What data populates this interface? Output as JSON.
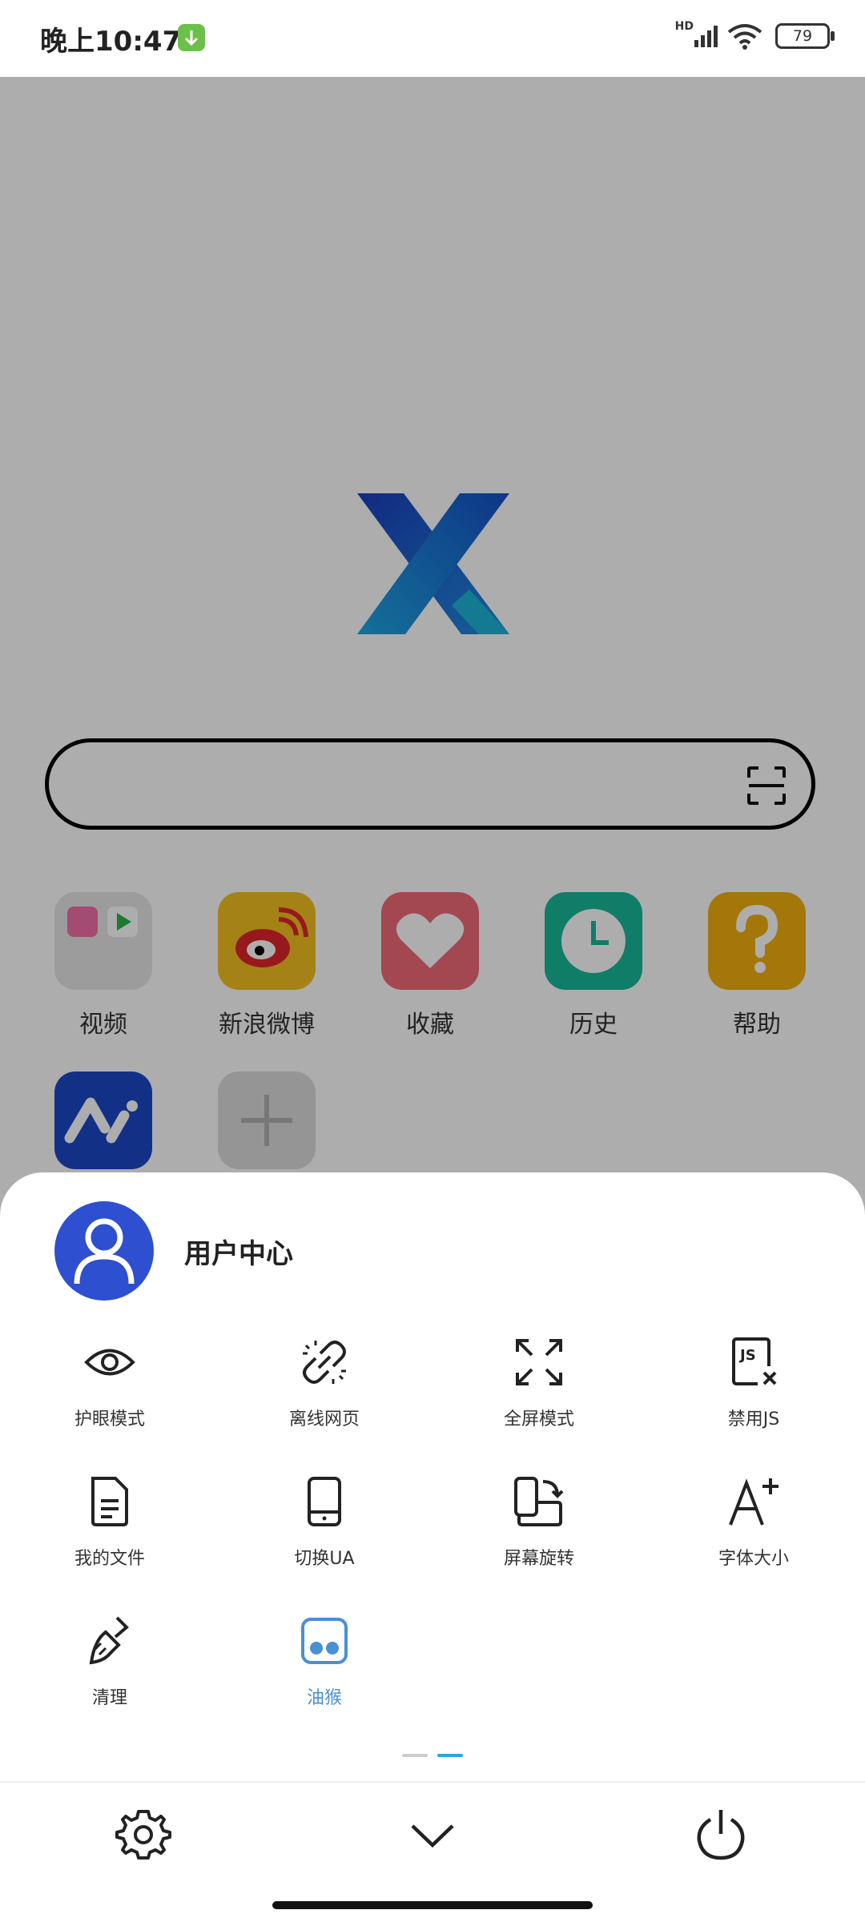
{
  "status_bar": {
    "time": "晚上10:47",
    "network_label": "HD",
    "battery": "79"
  },
  "search": {
    "placeholder": ""
  },
  "shortcuts": [
    {
      "label": "视频",
      "icon": "video-folder-icon",
      "color": "#e6e6e6"
    },
    {
      "label": "新浪微博",
      "icon": "weibo-icon",
      "color": "#f4c020"
    },
    {
      "label": "收藏",
      "icon": "heart-icon",
      "color": "#f06a78"
    },
    {
      "label": "历史",
      "icon": "clock-icon",
      "color": "#18b89b"
    },
    {
      "label": "帮助",
      "icon": "question-icon",
      "color": "#f2b010"
    },
    {
      "label": "",
      "icon": "ai-app-icon",
      "color": "#1c48c8"
    },
    {
      "label": "",
      "icon": "add-icon",
      "color": "#dcdcdc"
    }
  ],
  "sheet": {
    "user_center": "用户中心",
    "menu": [
      {
        "label": "护眼模式",
        "icon": "eye-icon"
      },
      {
        "label": "离线网页",
        "icon": "offline-link-icon"
      },
      {
        "label": "全屏模式",
        "icon": "fullscreen-icon"
      },
      {
        "label": "禁用JS",
        "icon": "disable-js-icon"
      },
      {
        "label": "我的文件",
        "icon": "file-icon"
      },
      {
        "label": "切换UA",
        "icon": "phone-ua-icon"
      },
      {
        "label": "屏幕旋转",
        "icon": "rotate-icon"
      },
      {
        "label": "字体大小",
        "icon": "font-size-icon"
      },
      {
        "label": "清理",
        "icon": "broom-icon"
      },
      {
        "label": "油猴",
        "icon": "tampermonkey-icon"
      }
    ],
    "pager": {
      "pages": 2,
      "current": 2
    },
    "bottom_actions": [
      {
        "name": "settings",
        "icon": "gear-icon"
      },
      {
        "name": "collapse",
        "icon": "chevron-down-icon"
      },
      {
        "name": "exit",
        "icon": "power-icon"
      }
    ]
  },
  "colors": {
    "accent": "#4a8fd4",
    "avatar_bg": "#2e4fcf",
    "pager_active": "#2aa7d8",
    "pager_inactive": "#cccccc"
  }
}
